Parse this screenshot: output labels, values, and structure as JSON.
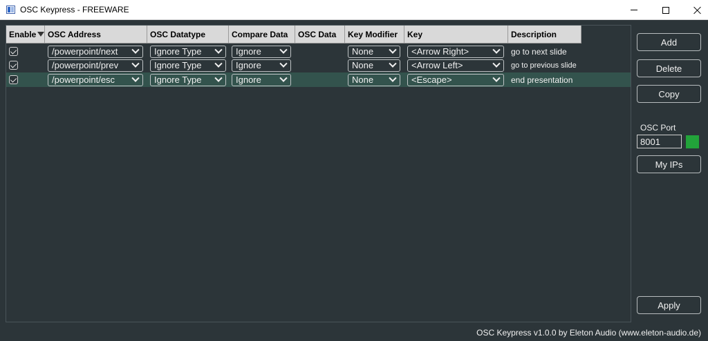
{
  "window": {
    "title": "OSC Keypress - FREEWARE"
  },
  "table": {
    "columns": [
      "Enable",
      "OSC Address",
      "OSC Datatype",
      "Compare Data",
      "OSC Data",
      "Key Modifier",
      "Key",
      "Description"
    ],
    "rows": [
      {
        "enabled": true,
        "address": "/powerpoint/next",
        "datatype": "Ignore Type",
        "compare": "Ignore",
        "osc_data": "",
        "modifier": "None",
        "key": "<Arrow Right>",
        "description": "go to next slide"
      },
      {
        "enabled": true,
        "address": "/powerpoint/prev",
        "datatype": "Ignore Type",
        "compare": "Ignore",
        "osc_data": "",
        "modifier": "None",
        "key": "<Arrow Left>",
        "description": "go to previous slide"
      },
      {
        "enabled": true,
        "address": "/powerpoint/esc",
        "datatype": "Ignore Type",
        "compare": "Ignore",
        "osc_data": "",
        "modifier": "None",
        "key": "<Escape>",
        "description": "end presentation"
      }
    ]
  },
  "panel": {
    "add_label": "Add",
    "delete_label": "Delete",
    "copy_label": "Copy",
    "port_label": "OSC Port",
    "port_value": "8001",
    "myips_label": "My IPs",
    "apply_label": "Apply"
  },
  "footer": {
    "text": "OSC Keypress v1.0.0 by Eleton Audio (www.eleton-audio.de)"
  },
  "colors": {
    "background": "#2c3539",
    "selected_row": "#33534d",
    "port_status": "#22a33a",
    "header": "#d9d9d9"
  }
}
